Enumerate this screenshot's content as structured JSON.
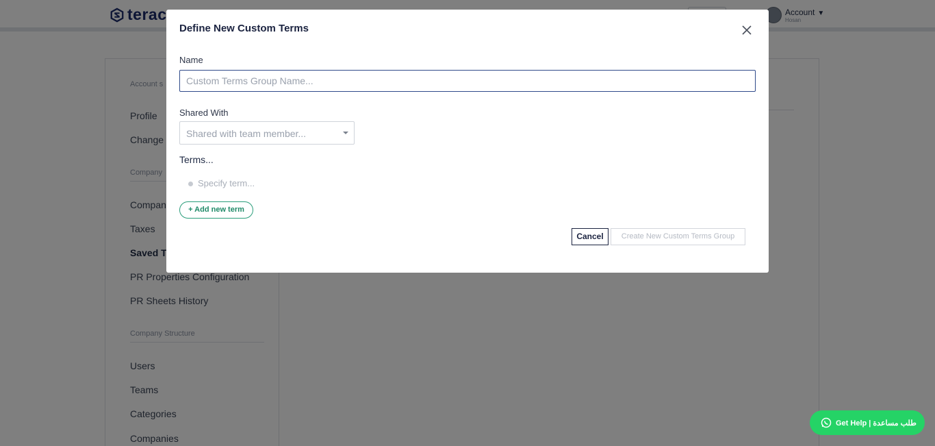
{
  "app": {
    "logo_text": "terac",
    "account_label": "Account",
    "account_sub": "Hosan"
  },
  "sidebar": {
    "section_account": "Account s",
    "section_company": "Company",
    "section_structure": "Company Structure",
    "items": [
      {
        "label": "Profile"
      },
      {
        "label": "Change P"
      },
      {
        "label": "Compan"
      },
      {
        "label": "Taxes"
      },
      {
        "label": "Saved Te"
      },
      {
        "label": "PR Properties Configuration"
      },
      {
        "label": "PR Sheets History"
      },
      {
        "label": "Users"
      },
      {
        "label": "Teams"
      },
      {
        "label": "Categories"
      },
      {
        "label": "Companies"
      }
    ]
  },
  "modal": {
    "title": "Define New Custom Terms",
    "name_label": "Name",
    "name_placeholder": "Custom Terms Group Name...",
    "name_value": "",
    "shared_label": "Shared With",
    "shared_placeholder": "Shared with team member...",
    "terms_label": "Terms...",
    "term_placeholder": "Specify term...",
    "add_term_label": "+ Add new term",
    "cancel_label": "Cancel",
    "create_label": "Create New Custom Terms Group"
  },
  "help": {
    "label": "Get Help | طلب مساعدة"
  },
  "colors": {
    "accent": "#1b2a6b",
    "success": "#25d366",
    "add_term": "#2a9d7a"
  }
}
